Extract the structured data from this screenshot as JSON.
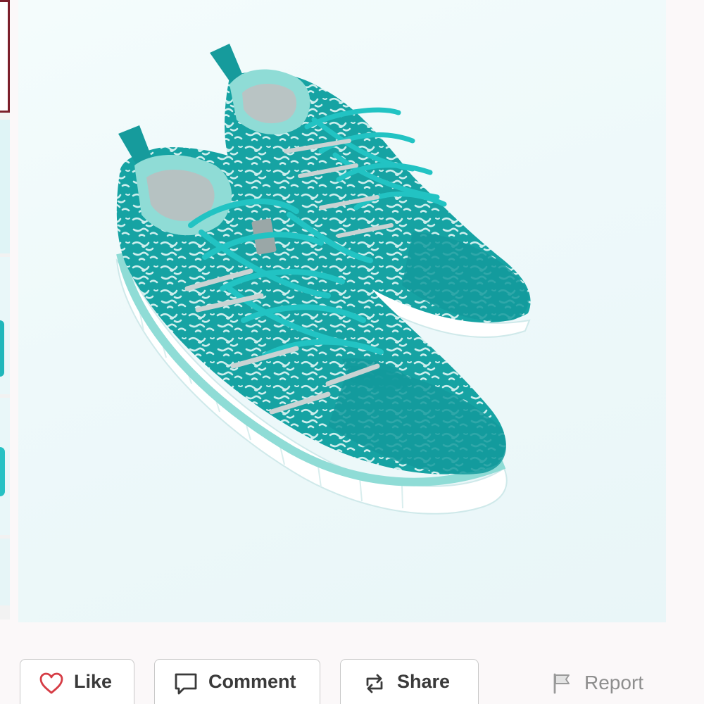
{
  "thumbnails": [
    {
      "label": "photo-1",
      "selected": true
    },
    {
      "label": "photo-2",
      "selected": false
    },
    {
      "label": "photo-3",
      "selected": false
    },
    {
      "label": "photo-4",
      "selected": false
    },
    {
      "label": "photo-5",
      "selected": false
    }
  ],
  "product_image": {
    "subject": "teal patterned running sneakers pair",
    "colors": {
      "shoe": "#1aa2a3",
      "accent": "#7fd9d4",
      "sole": "#ffffff"
    }
  },
  "actions": {
    "like": {
      "label": "Like",
      "icon": "heart-icon"
    },
    "comment": {
      "label": "Comment",
      "icon": "speech-bubble-icon"
    },
    "share": {
      "label": "Share",
      "icon": "repost-icon"
    },
    "report": {
      "label": "Report",
      "icon": "flag-icon"
    }
  },
  "theme": {
    "accent": "#7c1f2b",
    "heart": "#d63c45",
    "text": "#3a3a3a",
    "muted": "#8e8e8e"
  }
}
